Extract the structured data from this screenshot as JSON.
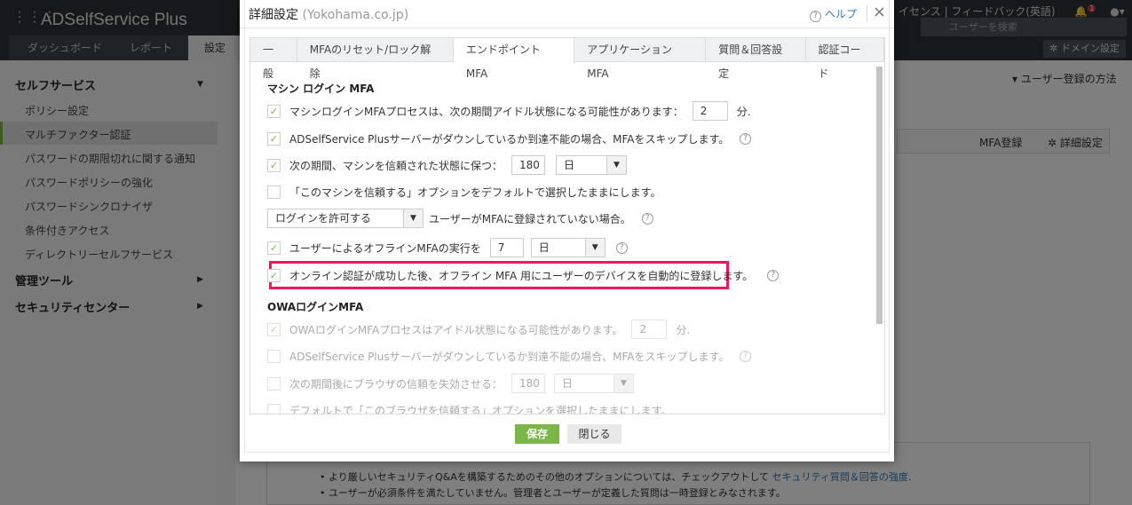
{
  "app": {
    "logo": "ADSelfService Plus",
    "nav_tabs": [
      "ダッシュボード",
      "レポート",
      "設定"
    ],
    "top_links": "イセンス | フィードバック(英語)",
    "notif_count": "1",
    "search_placeholder": "ユーザーを検索",
    "domain_settings": "ドメイン設定"
  },
  "sidebar": {
    "sections": [
      {
        "label": "セルフサービス",
        "items": [
          "ポリシー設定",
          "マルチファクター認証",
          "パスワードの期限切れに関する通知",
          "パスワードポリシーの強化",
          "パスワードシンクロナイザ",
          "条件付きアクセス",
          "ディレクトリーセルフサービス"
        ]
      },
      {
        "label": "管理ツール"
      },
      {
        "label": "セキュリティセンター"
      }
    ]
  },
  "main": {
    "enroll_method": "ユーザー登録の方法",
    "mfa_enroll": "MFA登録",
    "advanced": "詳細設定",
    "notes": [
      "より厳しいセキュリティQ&Aを構築するためのその他のオプションについては、チェックアウトして",
      "ユーザーが必須条件を満たしていません。管理者とユーザーが定義した質問は一時登録とみなされます。"
    ],
    "note_link": "セキュリティ質問＆回答の強度",
    "note_suffix": "."
  },
  "dialog": {
    "title": "詳細設定",
    "domain": "(Yokohama.co.jp)",
    "help": "ヘルプ",
    "tabs": [
      "一般",
      "MFAのリセット/ロック解除",
      "エンドポイントMFA",
      "アプリケーションMFA",
      "質問＆回答設定",
      "認証コード"
    ],
    "machine_heading": "マシン ログイン MFA",
    "m1": "マシンログインMFAプロセスは、次の期間アイドル状態になる可能性があります：",
    "m1_val": "2",
    "m1_unit": "分.",
    "m2": "ADSelfService Plusサーバーがダウンしているか到達不能の場合、MFAをスキップします。",
    "m3": "次の期間、マシンを信頼された状態に保つ：",
    "m3_val": "180",
    "m3_unit": "日",
    "m4": "「このマシンを信頼する」オプションをデフォルトで選択したままにします。",
    "m5_sel": "ログインを許可する",
    "m5": "ユーザーがMFAに登録されていない場合。",
    "m6": "ユーザーによるオフラインMFAの実行を",
    "m6_val": "7",
    "m6_unit": "日",
    "m7": "オンライン認証が成功した後、オフライン MFA 用にユーザーのデバイスを自動的に登録します。",
    "owa_heading": "OWAログインMFA",
    "o1": "OWAログインMFAプロセスはアイドル状態になる可能性があります。",
    "o1_val": "2",
    "o1_unit": "分.",
    "o2": "ADSelfService Plusサーバーがダウンしているか到達不能の場合、MFAをスキップします。",
    "o3": "次の期間後にブラウザの信頼を失効させる：",
    "o3_val": "180",
    "o3_unit": "日",
    "o4": "デフォルトで「このブラウザを信頼する」オプションを選択したままにします。",
    "save": "保存",
    "close": "閉じる"
  },
  "colors": {
    "accent": "#7ab648",
    "highlight": "#f0185a",
    "link": "#2a7ab8"
  }
}
